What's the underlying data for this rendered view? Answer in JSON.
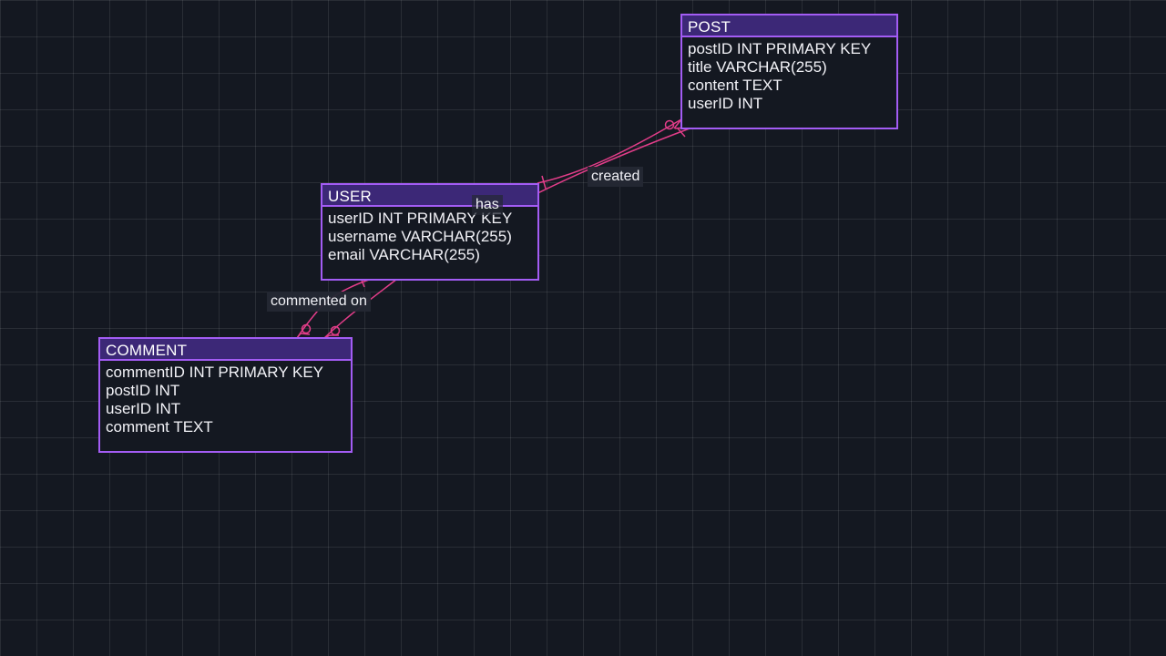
{
  "colors": {
    "background": "#141821",
    "grid": "#2a2f3a",
    "entity_border": "#a35cf4",
    "entity_header": "#3c2877",
    "edge": "#e23d89",
    "text": "#f2f2f7"
  },
  "entities": {
    "post": {
      "title": "POST",
      "attributes": [
        "postID INT PRIMARY KEY",
        "title VARCHAR(255)",
        "content TEXT",
        "userID INT"
      ]
    },
    "user": {
      "title": "USER",
      "attributes": [
        "userID INT PRIMARY KEY",
        "username VARCHAR(255)",
        "email VARCHAR(255)"
      ]
    },
    "comment": {
      "title": "COMMENT",
      "attributes": [
        "commentID INT PRIMARY KEY",
        "postID INT",
        "userID INT",
        "comment TEXT"
      ]
    }
  },
  "relationships": {
    "created": {
      "label": "created",
      "from": "USER",
      "to": "POST",
      "from_cardinality": "one",
      "to_cardinality": "zero-or-many"
    },
    "has": {
      "label": "has",
      "from": "POST",
      "to": "COMMENT",
      "from_cardinality": "one",
      "to_cardinality": "zero-or-many"
    },
    "commented_on": {
      "label": "commented on",
      "from": "USER",
      "to": "COMMENT",
      "from_cardinality": "one",
      "to_cardinality": "zero-or-many"
    }
  }
}
